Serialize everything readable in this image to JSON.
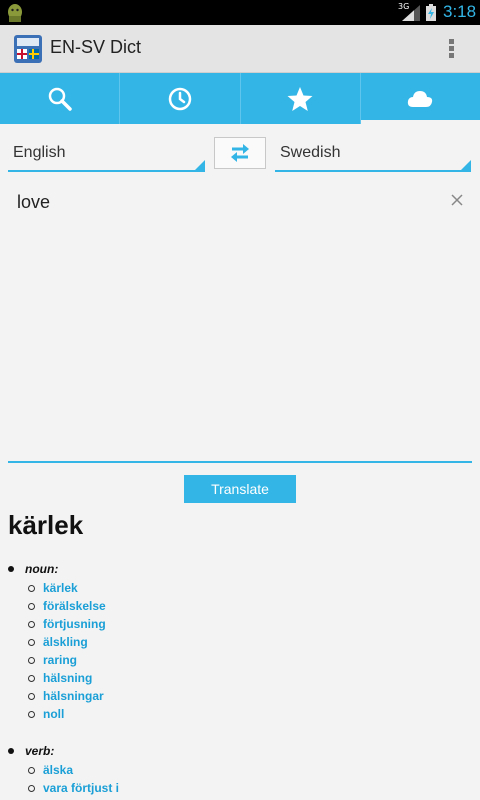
{
  "status_bar": {
    "network": "3G",
    "time": "3:18"
  },
  "app": {
    "title": "EN-SV Dict"
  },
  "tabs": [
    {
      "icon": "search-icon"
    },
    {
      "icon": "history-icon"
    },
    {
      "icon": "star-icon"
    },
    {
      "icon": "cloud-icon",
      "active": true
    }
  ],
  "languages": {
    "source": "English",
    "target": "Swedish"
  },
  "input": {
    "value": "love"
  },
  "translate_button": {
    "label": "Translate"
  },
  "result": {
    "headword": "kärlek",
    "parts": [
      {
        "pos": "noun:",
        "words": [
          "kärlek",
          "förälskelse",
          "förtjusning",
          "älskling",
          "raring",
          "hälsning",
          "hälsningar",
          "noll"
        ]
      },
      {
        "pos": "verb:",
        "words": [
          "älska",
          "vara förtjust i"
        ]
      }
    ]
  },
  "colors": {
    "accent": "#33b5e5",
    "link": "#1a9fd6"
  }
}
